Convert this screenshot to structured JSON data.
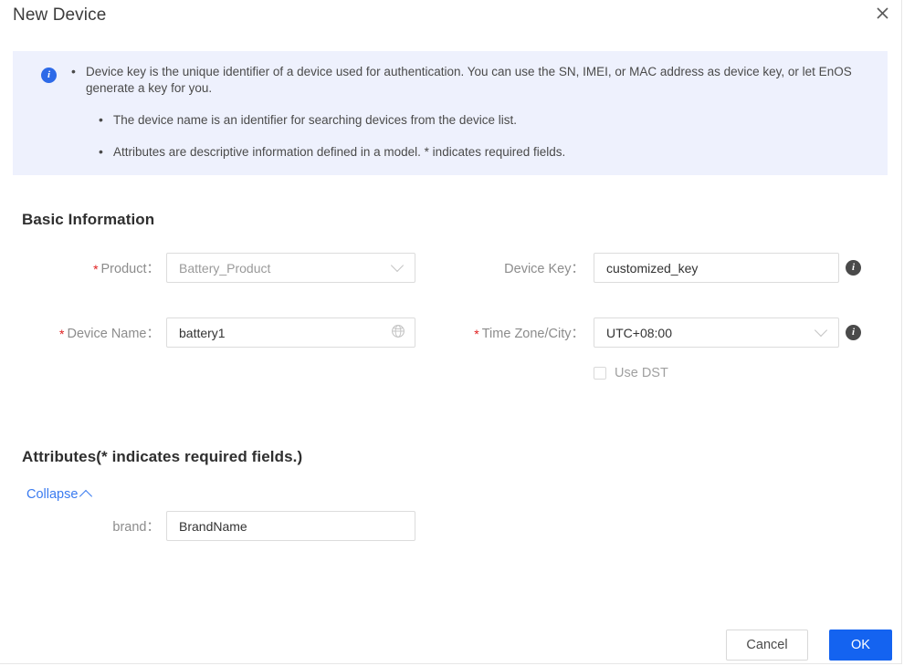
{
  "dialog": {
    "title": "New Device",
    "close_icon": "close-icon"
  },
  "banner": {
    "icon": "info-circle-icon",
    "items": [
      "Device key is the unique identifier of a device used for authentication. You can use the SN, IMEI, or MAC address as device key, or let EnOS generate a key for you.",
      "The device name is an identifier for searching devices from the device list.",
      "Attributes are descriptive information defined in a model. * indicates required fields."
    ]
  },
  "basic_information": {
    "section_title": "Basic Information",
    "product": {
      "label": "Product：",
      "required": "*",
      "value": "Battery_Product",
      "control": "select",
      "chevron_icon": "chevron-down-icon"
    },
    "device_key": {
      "label": "Device Key：",
      "required": "",
      "value": "customized_key",
      "control": "input",
      "info_icon": "info-circle-icon",
      "info_glyph": "i"
    },
    "device_name": {
      "label": "Device Name：",
      "required": "*",
      "value": "battery1",
      "control": "input",
      "suffix_icon": "globe-language-icon"
    },
    "time_zone": {
      "label": "Time Zone/City：",
      "required": "*",
      "value": "UTC+08:00",
      "control": "select",
      "chevron_icon": "chevron-down-icon",
      "info_icon": "info-circle-icon",
      "info_glyph": "i"
    },
    "use_dst": {
      "label": "Use DST",
      "checked": false
    }
  },
  "attributes": {
    "section_title": "Attributes(* indicates required fields.)",
    "collapse_label": "Collapse",
    "collapse_icon": "caret-up-icon",
    "fields": [
      {
        "label": "brand：",
        "required": "",
        "value": "BrandName"
      }
    ]
  },
  "footer": {
    "cancel_label": "Cancel",
    "ok_label": "OK"
  },
  "colors": {
    "primary": "#1463f0",
    "link": "#3a7bf0",
    "banner_bg": "#eef1fd",
    "required_asterisk": "#e02020",
    "info_icon_blue": "#2d6ae8",
    "info_icon_dark": "#4a4a4a"
  }
}
